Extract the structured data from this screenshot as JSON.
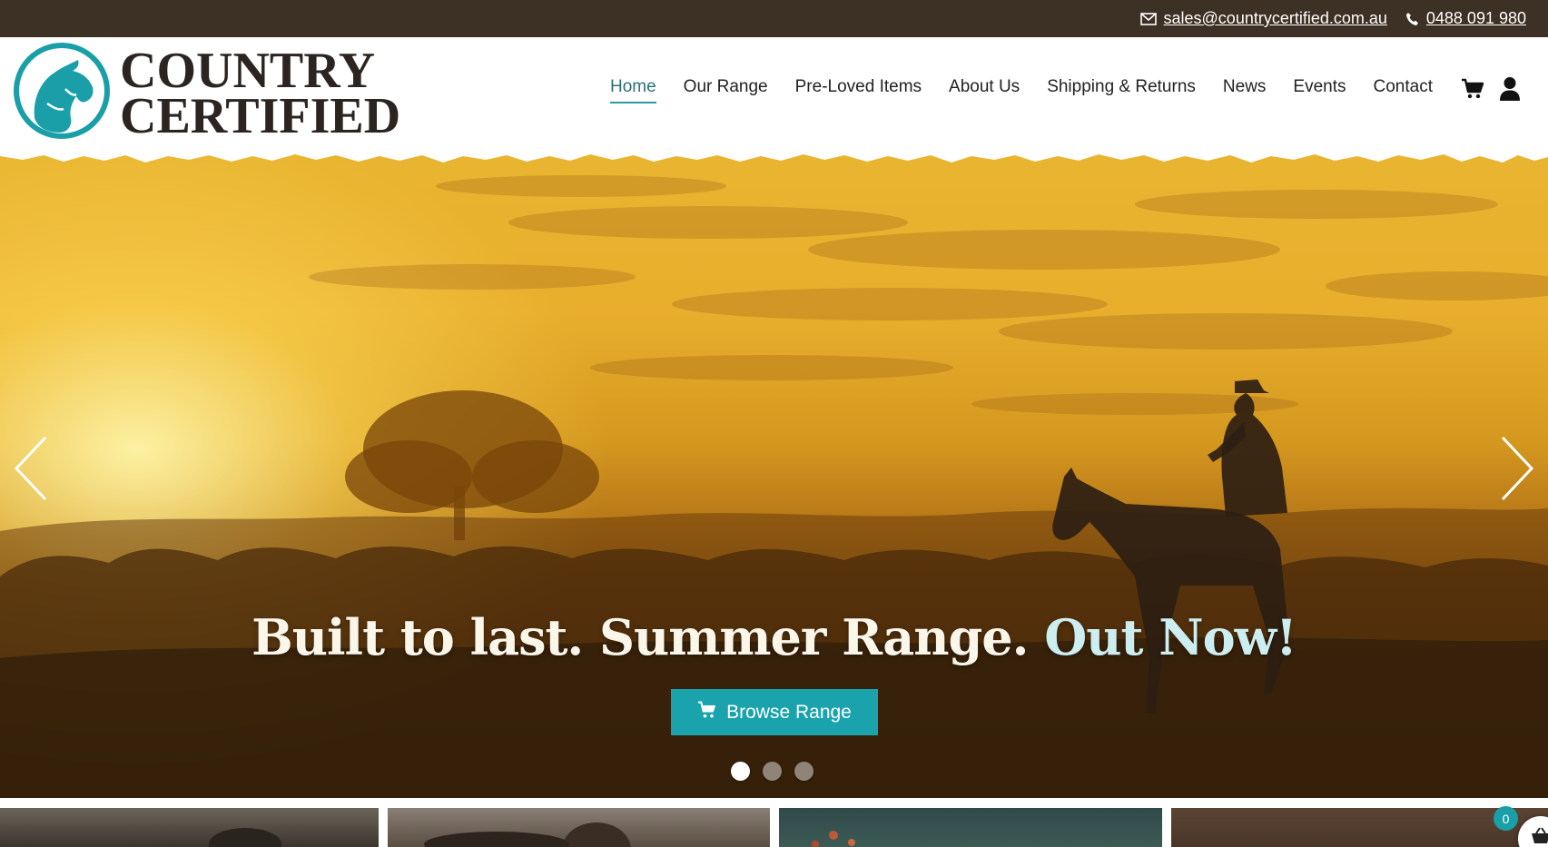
{
  "topbar": {
    "email": "sales@countrycertified.com.au",
    "phone": "0488 091 980",
    "email_icon": "envelope-icon",
    "phone_icon": "phone-icon"
  },
  "logo": {
    "line1": "COUNTRY",
    "line2": "CERTIFIED",
    "icon": "horse-head-icon",
    "color": "#1a9fa8"
  },
  "nav": {
    "items": [
      {
        "label": "Home",
        "active": true
      },
      {
        "label": "Our Range"
      },
      {
        "label": "Pre-Loved Items"
      },
      {
        "label": "About Us"
      },
      {
        "label": "Shipping & Returns"
      },
      {
        "label": "News"
      },
      {
        "label": "Events"
      },
      {
        "label": "Contact"
      }
    ],
    "cart_icon": "cart-icon",
    "account_icon": "user-icon"
  },
  "hero": {
    "headline_main": "Built to last. Summer Range. ",
    "headline_accent": "Out Now!",
    "cta_label": "Browse Range",
    "cta_icon": "cart-icon",
    "slides_total": 3,
    "active_slide": 1,
    "accent_color": "#1aa3ad"
  },
  "mini_cart": {
    "count": "0",
    "icon": "basket-icon"
  }
}
